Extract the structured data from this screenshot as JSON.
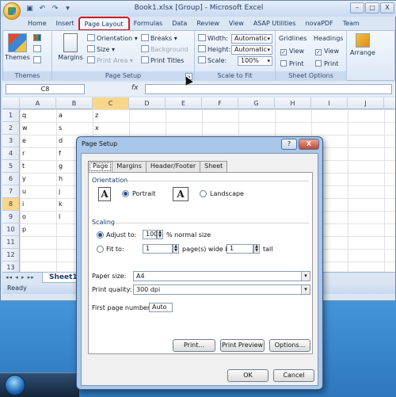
{
  "window": {
    "title": "Book1.xlsx  [Group]  -  Microsoft Excel",
    "controls": [
      "–",
      "□",
      "X"
    ]
  },
  "ribbon_tabs": [
    "Home",
    "Insert",
    "Page Layout",
    "Formulas",
    "Data",
    "Review",
    "View",
    "ASAP Utilities",
    "novaPDF",
    "Team"
  ],
  "ribbon": {
    "themes": {
      "themes_label": "Themes",
      "group": "Themes"
    },
    "page_setup": {
      "margins": "Margins",
      "orientation": "Orientation",
      "size": "Size",
      "print_area": "Print Area",
      "breaks": "Breaks",
      "background": "Background",
      "print_titles": "Print Titles",
      "group": "Page Setup"
    },
    "scale_to_fit": {
      "width_label": "Width:",
      "width_value": "Automatic",
      "height_label": "Height:",
      "height_value": "Automatic",
      "scale_label": "Scale:",
      "scale_value": "100%",
      "group": "Scale to Fit"
    },
    "sheet_options": {
      "gridlines": "Gridlines",
      "headings": "Headings",
      "view": "View",
      "print": "Print",
      "group": "Sheet Options"
    },
    "arrange": {
      "label": "Arrange"
    }
  },
  "formula_bar": {
    "name_box": "C8",
    "fx": "fx",
    "value": ""
  },
  "sheet": {
    "columns": [
      "A",
      "B",
      "C",
      "D",
      "E",
      "F",
      "G",
      "H",
      "I",
      "J"
    ],
    "rows": [
      "1",
      "2",
      "3",
      "4",
      "5",
      "6",
      "7",
      "8",
      "9",
      "10",
      "11",
      "12",
      "13"
    ],
    "colA": [
      "q",
      "w",
      "e",
      "r",
      "t",
      "y",
      "u",
      "i",
      "o",
      "p"
    ],
    "colB": [
      "a",
      "s",
      "d",
      "f",
      "g",
      "h",
      "j",
      "k",
      "l"
    ],
    "colC": [
      "z",
      "x"
    ],
    "tab": "Sheet1",
    "status": "Ready"
  },
  "dialog": {
    "title": "Page Setup",
    "help": "?",
    "close": "X",
    "tabs": [
      "Page",
      "Margins",
      "Header/Footer",
      "Sheet"
    ],
    "orientation_label": "Orientation",
    "portrait": "Portrait",
    "landscape": "Landscape",
    "scaling_label": "Scaling",
    "adjust_to": "Adjust to:",
    "adjust_value": "100",
    "adjust_suffix": "% normal size",
    "fit_to": "Fit to:",
    "fit_wide": "1",
    "fit_wide_suffix": "page(s) wide by",
    "fit_tall": "1",
    "fit_tall_suffix": "tall",
    "paper_size_label": "Paper size:",
    "paper_size": "A4",
    "print_quality_label": "Print quality:",
    "print_quality": "300 dpi",
    "first_page_label": "First page number:",
    "first_page": "Auto",
    "buttons": {
      "print": "Print...",
      "preview": "Print Preview",
      "options": "Options...",
      "ok": "OK",
      "cancel": "Cancel"
    }
  }
}
